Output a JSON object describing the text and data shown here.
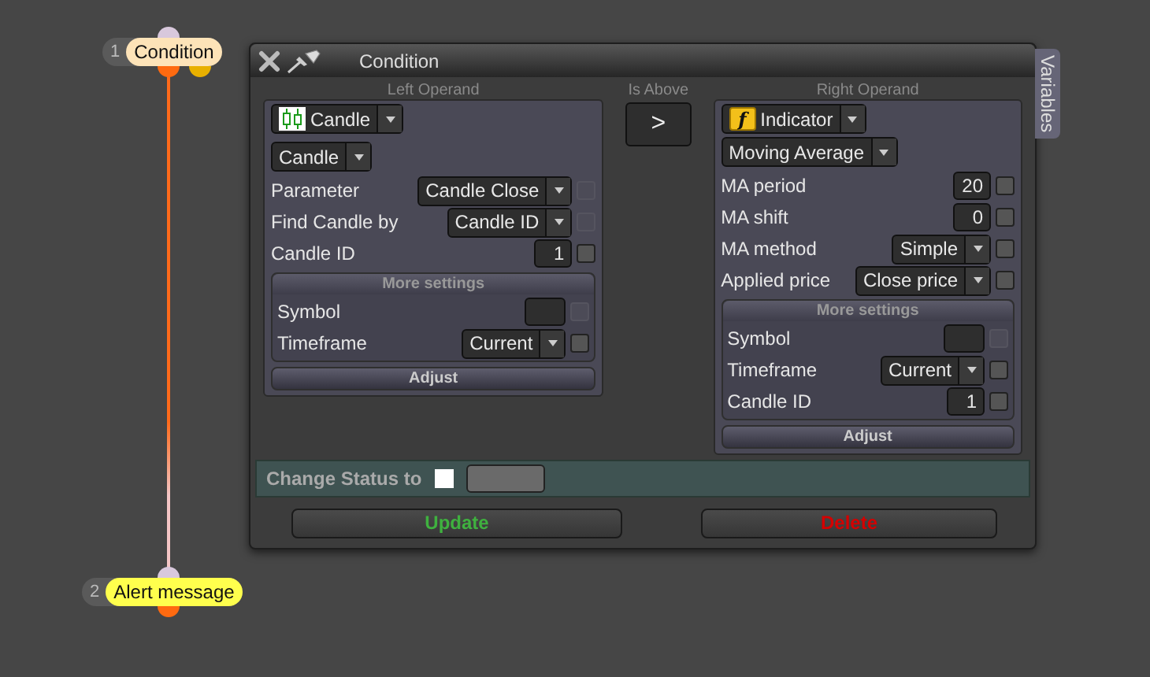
{
  "nodes": [
    {
      "number": "1",
      "label": "Condition",
      "color": "#fde3b8"
    },
    {
      "number": "2",
      "label": "Alert message",
      "color": "#ffff4d"
    }
  ],
  "dialog": {
    "title": "Condition",
    "side_tab": "Variables",
    "left": {
      "heading": "Left Operand",
      "type_select": {
        "kind": "candle",
        "value": "Candle"
      },
      "subtype_select": "Candle",
      "params": [
        {
          "kind": "select",
          "label": "Parameter",
          "value": "Candle Close",
          "disabled": true,
          "checked": false
        },
        {
          "kind": "select",
          "label": "Find Candle by",
          "value": "Candle ID",
          "disabled": true,
          "checked": false
        },
        {
          "kind": "number",
          "label": "Candle ID",
          "value": "1",
          "disabled": false,
          "checked": false
        }
      ],
      "more_settings": {
        "heading": "More settings",
        "params": [
          {
            "kind": "text",
            "label": "Symbol",
            "disabled": true,
            "checked": false
          },
          {
            "kind": "select",
            "label": "Timeframe",
            "value": "Current",
            "disabled": false,
            "checked": false
          }
        ]
      },
      "adjust": "Adjust"
    },
    "comparator": {
      "heading": "Is Above",
      "symbol": ">"
    },
    "right": {
      "heading": "Right Operand",
      "type_select": {
        "kind": "indicator",
        "icon_text": "f",
        "value": "Indicator"
      },
      "subtype_select": "Moving Average",
      "params": [
        {
          "kind": "number",
          "label": "MA period",
          "value": "20",
          "disabled": false,
          "checked": false
        },
        {
          "kind": "number",
          "label": "MA shift",
          "value": "0",
          "disabled": false,
          "checked": false
        },
        {
          "kind": "select",
          "label": "MA method",
          "value": "Simple",
          "disabled": false,
          "checked": false
        },
        {
          "kind": "select",
          "label": "Applied price",
          "value": "Close price",
          "disabled": false,
          "checked": false
        }
      ],
      "more_settings": {
        "heading": "More settings",
        "params": [
          {
            "kind": "text",
            "label": "Symbol",
            "disabled": true,
            "checked": false
          },
          {
            "kind": "select",
            "label": "Timeframe",
            "value": "Current",
            "disabled": false,
            "checked": false
          },
          {
            "kind": "number",
            "label": "Candle ID",
            "value": "1",
            "disabled": false,
            "checked": false
          }
        ]
      },
      "adjust": "Adjust"
    },
    "status": {
      "label": "Change Status to",
      "checked": false
    },
    "buttons": [
      {
        "kind": "update",
        "label": "Update"
      },
      {
        "kind": "delete",
        "label": "Delete"
      }
    ]
  }
}
